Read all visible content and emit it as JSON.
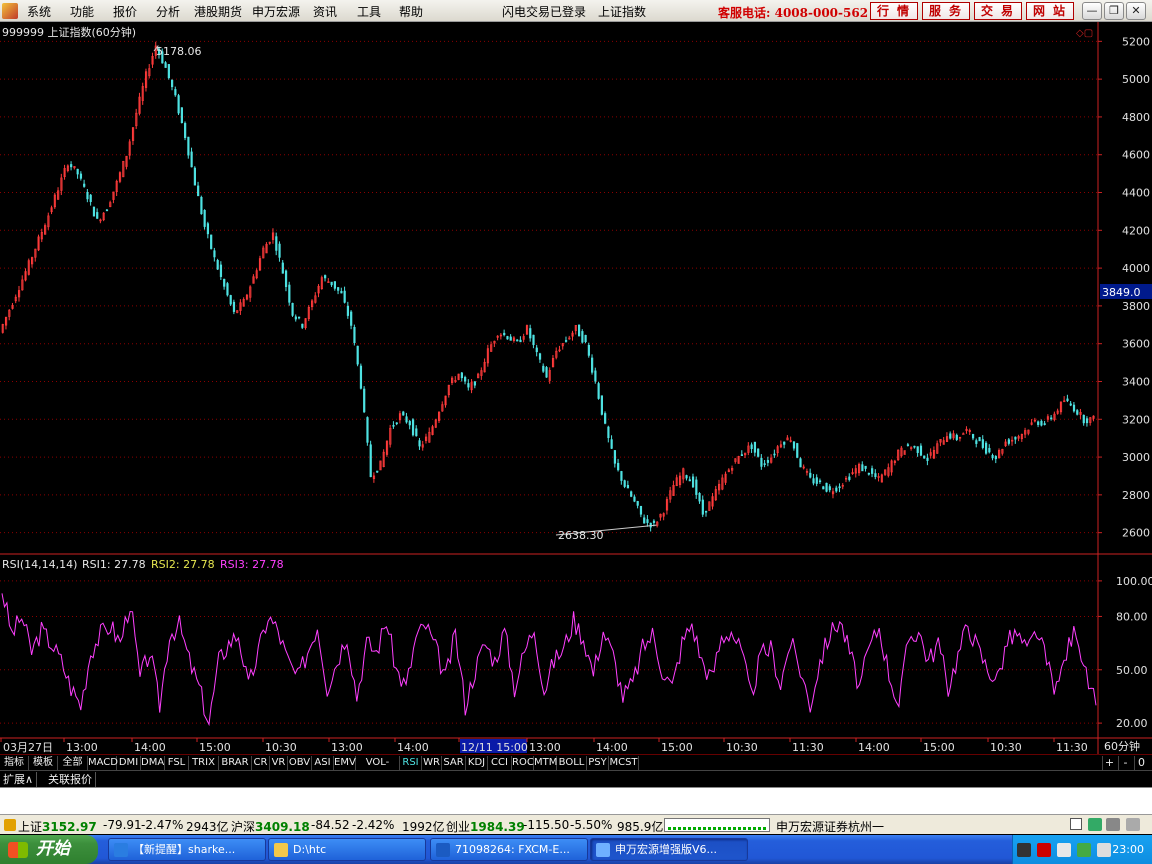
{
  "menubar": {
    "items": [
      "系统",
      "功能",
      "报价",
      "分析",
      "港股期货",
      "申万宏源",
      "资讯",
      "工具",
      "帮助"
    ],
    "login_status": "闪电交易已登录",
    "current_symbol": "上证指数",
    "hotline": "客服电话: 4008-000-562",
    "service_buttons": [
      "行情",
      "服务",
      "交易",
      "网站"
    ]
  },
  "chart_panel": {
    "title": "999999 上证指数(60分钟)",
    "current_price_label": "3849.0",
    "high_label": "5178.06",
    "low_label": "2638.30"
  },
  "rsi_panel": {
    "name": "RSI(14,14,14)",
    "rsi1": "RSI1: 27.78",
    "rsi2": "RSI2: 27.78",
    "rsi3": "RSI3: 27.78"
  },
  "time_axis": {
    "labels": [
      "03月27日",
      "13:00",
      "14:00",
      "15:00",
      "10:30",
      "13:00",
      "14:00",
      "12/11 15:00",
      "13:00",
      "14:00",
      "15:00",
      "10:30",
      "11:30",
      "14:00",
      "15:00",
      "10:30",
      "11:30"
    ],
    "period": "60分钟"
  },
  "chart_data": [
    {
      "type": "line",
      "title": "999999 上证指数(60分钟)",
      "y_ticks": [
        2600,
        2800,
        3000,
        3200,
        3400,
        3600,
        3800,
        4000,
        4200,
        4400,
        4600,
        4800,
        5000,
        5200
      ],
      "ylim": [
        2540,
        5260
      ],
      "current_value": 3849.0,
      "series": [
        {
          "values": [
            3660,
            3780,
            3900,
            4020,
            4150,
            4280,
            4420,
            4560,
            4500,
            4380,
            4250,
            4320,
            4450,
            4600,
            4820,
            5020,
            5178,
            5060,
            4900,
            4700,
            4450,
            4220,
            4050,
            3900,
            3760,
            3820,
            3950,
            4100,
            4180,
            3980,
            3760,
            3700,
            3820,
            3950,
            3920,
            3860,
            3700,
            3380,
            2900,
            2960,
            3150,
            3220,
            3180,
            3050,
            3120,
            3250,
            3380,
            3440,
            3360,
            3420,
            3560,
            3660,
            3640,
            3600,
            3680,
            3540,
            3420,
            3560,
            3620,
            3680,
            3600,
            3400,
            3160,
            2960,
            2850,
            2760,
            2660,
            2640,
            2720,
            2850,
            2920,
            2860,
            2700,
            2780,
            2880,
            2960,
            3020,
            3060,
            2960,
            3000,
            3080,
            3100,
            2960,
            2880,
            2860,
            2820,
            2850,
            2900,
            2950,
            2920,
            2880,
            2940,
            3020,
            3060,
            3040,
            2990,
            3060,
            3120,
            3100,
            3140,
            3090,
            3040,
            3000,
            3080,
            3100,
            3140,
            3190,
            3180,
            3230,
            3300,
            3260,
            3200
          ]
        }
      ]
    },
    {
      "type": "line",
      "title": "RSI(14,14,14)",
      "y_ticks": [
        20.0,
        50.0,
        80.0,
        100.0
      ],
      "ylim": [
        15,
        105
      ],
      "series": [
        {
          "name": "RSI3",
          "values": [
            95,
            70,
            80,
            60,
            72,
            65,
            55,
            40,
            30,
            60,
            70,
            75,
            65,
            88,
            45,
            60,
            30,
            70,
            75,
            55,
            40,
            20,
            55,
            65,
            70,
            40,
            60,
            80,
            72,
            55,
            45,
            60,
            75,
            40,
            55,
            70,
            35,
            65,
            60,
            78,
            50,
            40,
            68,
            75,
            62,
            45,
            70,
            30,
            50,
            65,
            55,
            72,
            40,
            60,
            74,
            38,
            55,
            62,
            78,
            68,
            48,
            72,
            58,
            35,
            42,
            62,
            70,
            50,
            40,
            65,
            76,
            55,
            45,
            68,
            72,
            60,
            35,
            58,
            62,
            42,
            66,
            50,
            30,
            55,
            70,
            78,
            60,
            40,
            62,
            74,
            48,
            30,
            68,
            72,
            55,
            65,
            40,
            58,
            76,
            62,
            50,
            45,
            66,
            70,
            60,
            72,
            54,
            38,
            60,
            74,
            46,
            30
          ]
        }
      ]
    }
  ],
  "indicator_tabs": [
    "指标",
    "模板",
    "全部",
    "MACD",
    "DMI",
    "DMA",
    "FSL",
    "TRIX",
    "BRAR",
    "CR",
    "VR",
    "OBV",
    "ASI",
    "EMV",
    "VOL-TDX",
    "RSI",
    "WR",
    "SAR",
    "KDJ",
    "CCI",
    "ROC",
    "MTM",
    "BOLL",
    "PSY",
    "MCST"
  ],
  "active_indicator": "RSI",
  "tab_controls": [
    "+",
    "-",
    "0"
  ],
  "ext_tabs": [
    "扩展∧",
    "关联报价"
  ],
  "ticker": {
    "sh_name": "上证",
    "sh_price": "3152.97",
    "sh_change": "-79.91",
    "sh_pct": "-2.47%",
    "sh_vol": "2943亿",
    "hs_name": "沪深",
    "hs_price": "3409.18",
    "hs_change": "-84.52",
    "hs_pct": "-2.42%",
    "hs_vol": "1992亿",
    "cy_name": "创业",
    "cy_price": "1984.39",
    "cy_change": "-115.50",
    "cy_pct": "-5.50%",
    "cy_vol": "985.9亿",
    "broker": "申万宏源证券杭州一"
  },
  "taskbar": {
    "start": "开始",
    "tasks": [
      "【新提醒】sharke...",
      "D:\\htc",
      "71098264: FXCM-E...",
      "申万宏源增强版V6..."
    ],
    "clock": "23:00"
  },
  "colors": {
    "up": "#ff3b3b",
    "down": "#4fe3e3",
    "rsi": "#ff40ff",
    "grid": "#8b0000",
    "axis": "#cc2222"
  }
}
